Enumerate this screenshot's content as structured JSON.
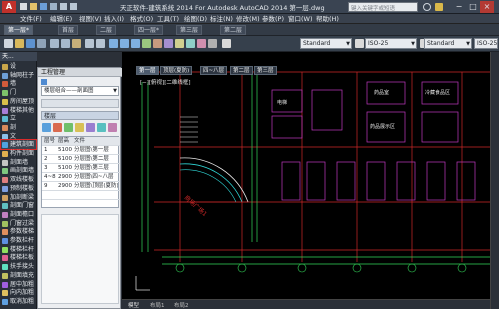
{
  "titlebar": {
    "logo": "A",
    "title": "天正软件-建筑系统 2014  For Autodesk AutoCAD 2014   第一层.dwg",
    "search_placeholder": "键入关键字或短语",
    "minimize": "−",
    "maximize": "□",
    "close": "×"
  },
  "menu": [
    "文件(F)",
    "编辑(E)",
    "视图(V)",
    "插入(I)",
    "格式(O)",
    "工具(T)",
    "绘图(D)",
    "标注(N)",
    "修改(M)",
    "参数(P)",
    "窗口(W)",
    "帮助(H)"
  ],
  "doc_tabs": [
    {
      "label": "第一层*",
      "active": true
    },
    {
      "label": "首层",
      "active": false
    },
    {
      "label": "二层",
      "active": false
    },
    {
      "label": "四一层*",
      "active": false
    },
    {
      "label": "第三层",
      "active": false
    },
    {
      "label": "第二层",
      "active": false
    }
  ],
  "toolbar": {
    "textstyle": "Standard",
    "dimstyle": "ISO-25",
    "tablestyle": "Standard",
    "mleaderstyle": "ISO-25"
  },
  "palette": {
    "header": "天...",
    "items": [
      {
        "label": "设",
        "color": "#c9a64a"
      },
      {
        "label": "轴网柱子",
        "color": "#6ea0d8"
      },
      {
        "label": "墙",
        "color": "#d25b3b"
      },
      {
        "label": "门",
        "color": "#7ec46a"
      },
      {
        "label": "房间屋顶",
        "color": "#d8c04a"
      },
      {
        "label": "楼梯其他",
        "color": "#a77ed8"
      },
      {
        "label": "立",
        "color": "#5bbad2"
      },
      {
        "label": "剖",
        "color": "#d88a5b"
      },
      {
        "label": "文",
        "color": "#8bbfe8"
      },
      {
        "label": "建筑剖面",
        "color": "#4fa3e0",
        "selected": true
      },
      {
        "label": "构件剖面",
        "color": "#e0b04f"
      },
      {
        "label": "剖面墙",
        "color": "#c4c4c4"
      },
      {
        "label": "画剖面墙",
        "color": "#7fc77f"
      },
      {
        "label": "双线楼板",
        "color": "#e07f7f"
      },
      {
        "label": "预制楼板",
        "color": "#7f9fe0"
      },
      {
        "label": "加剖断梁",
        "color": "#d0a060"
      },
      {
        "label": "剖面门窗",
        "color": "#60c0c0"
      },
      {
        "label": "剖面檐口",
        "color": "#c080c0"
      },
      {
        "label": "门窗过梁",
        "color": "#a0c060"
      },
      {
        "label": "参数楼梯",
        "color": "#e0905f"
      },
      {
        "label": "参数栏杆",
        "color": "#5f90e0"
      },
      {
        "label": "楼梯栏杆",
        "color": "#90e05f"
      },
      {
        "label": "楼梯栏板",
        "color": "#e05f90"
      },
      {
        "label": "扶手接头",
        "color": "#5fe0c0"
      },
      {
        "label": "剖面填充",
        "color": "#c0c05f"
      },
      {
        "label": "居中加粗",
        "color": "#a05fe0"
      },
      {
        "label": "向内加粗",
        "color": "#e0c05f"
      },
      {
        "label": "取消加粗",
        "color": "#5fa0e0"
      }
    ]
  },
  "project": {
    "title": "工程管理",
    "combo": "楼层组合——剖面图",
    "section": "楼层",
    "table": {
      "headers": [
        "层号",
        "层高",
        "文件"
      ],
      "rows": [
        [
          "1",
          "5100",
          "分层图\\第一层"
        ],
        [
          "2",
          "5100",
          "分层图\\第二层"
        ],
        [
          "3",
          "5100",
          "分层图\\第三层"
        ],
        [
          "4~8",
          "2900",
          "分层图\\四~八层"
        ],
        [
          "9",
          "2900",
          "分层图\\顶层(夏防)"
        ]
      ]
    }
  },
  "viewport": {
    "tabs": [
      {
        "label": "第一层",
        "active": true
      },
      {
        "label": "顶层(夏防)",
        "active": false
      },
      {
        "label": "四~八层",
        "active": false
      },
      {
        "label": "第二层",
        "active": false
      },
      {
        "label": "第三层",
        "active": false
      }
    ],
    "view_label": "[−][俯视][二维线框]",
    "room_labels": [
      "药品室",
      "药品展示区",
      "冷藏食品区",
      "电梯"
    ],
    "curve_label": "商场广场1",
    "bottom_tabs": [
      "模型",
      "布局1",
      "布局2"
    ],
    "axis_numbers": [
      "①",
      "②",
      "③",
      "④",
      "⑤",
      "⑥",
      "⑦",
      "⑧"
    ]
  }
}
